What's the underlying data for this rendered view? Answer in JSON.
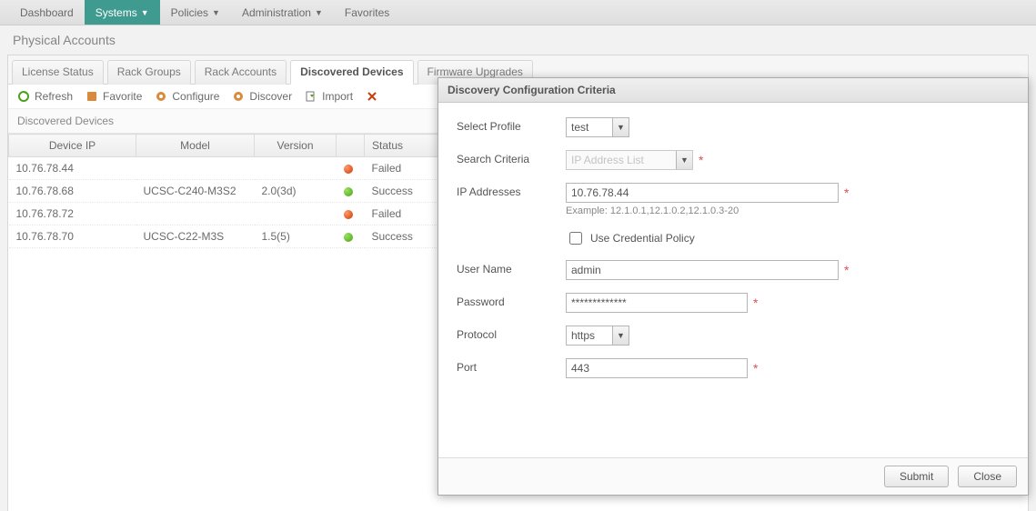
{
  "nav": {
    "items": [
      {
        "label": "Dashboard",
        "dropdown": false,
        "active": false
      },
      {
        "label": "Systems",
        "dropdown": true,
        "active": true
      },
      {
        "label": "Policies",
        "dropdown": true,
        "active": false
      },
      {
        "label": "Administration",
        "dropdown": true,
        "active": false
      },
      {
        "label": "Favorites",
        "dropdown": false,
        "active": false
      }
    ]
  },
  "page": {
    "title": "Physical Accounts"
  },
  "tabs": [
    {
      "label": "License Status",
      "active": false
    },
    {
      "label": "Rack Groups",
      "active": false
    },
    {
      "label": "Rack Accounts",
      "active": false
    },
    {
      "label": "Discovered Devices",
      "active": true
    },
    {
      "label": "Firmware Upgrades",
      "active": false
    }
  ],
  "toolbar": {
    "refresh": "Refresh",
    "favorite": "Favorite",
    "configure": "Configure",
    "discover": "Discover",
    "import": "Import"
  },
  "grid": {
    "title": "Discovered Devices",
    "columns": [
      "Device IP",
      "Model",
      "Version",
      "",
      "Status"
    ],
    "rows": [
      {
        "ip": "10.76.78.44",
        "model": "",
        "version": "",
        "status": "Failed",
        "ok": false
      },
      {
        "ip": "10.76.78.68",
        "model": "UCSC-C240-M3S2",
        "version": "2.0(3d)",
        "status": "Success",
        "ok": true
      },
      {
        "ip": "10.76.78.72",
        "model": "",
        "version": "",
        "status": "Failed",
        "ok": false
      },
      {
        "ip": "10.76.78.70",
        "model": "UCSC-C22-M3S",
        "version": "1.5(5)",
        "status": "Success",
        "ok": true
      }
    ]
  },
  "modal": {
    "title": "Discovery Configuration Criteria",
    "labels": {
      "select_profile": "Select Profile",
      "search_criteria": "Search Criteria",
      "ip_addresses": "IP Addresses",
      "ip_example": "Example: 12.1.0.1,12.1.0.2,12.1.0.3-20",
      "credential_policy": "Use Credential Policy",
      "user_name": "User Name",
      "password": "Password",
      "protocol": "Protocol",
      "port": "Port"
    },
    "values": {
      "profile": "test",
      "search_criteria": "IP Address List",
      "ip_addresses": "10.76.78.44",
      "credential_policy": false,
      "user_name": "admin",
      "password": "*************",
      "protocol": "https",
      "port": "443"
    },
    "buttons": {
      "submit": "Submit",
      "close": "Close"
    }
  }
}
